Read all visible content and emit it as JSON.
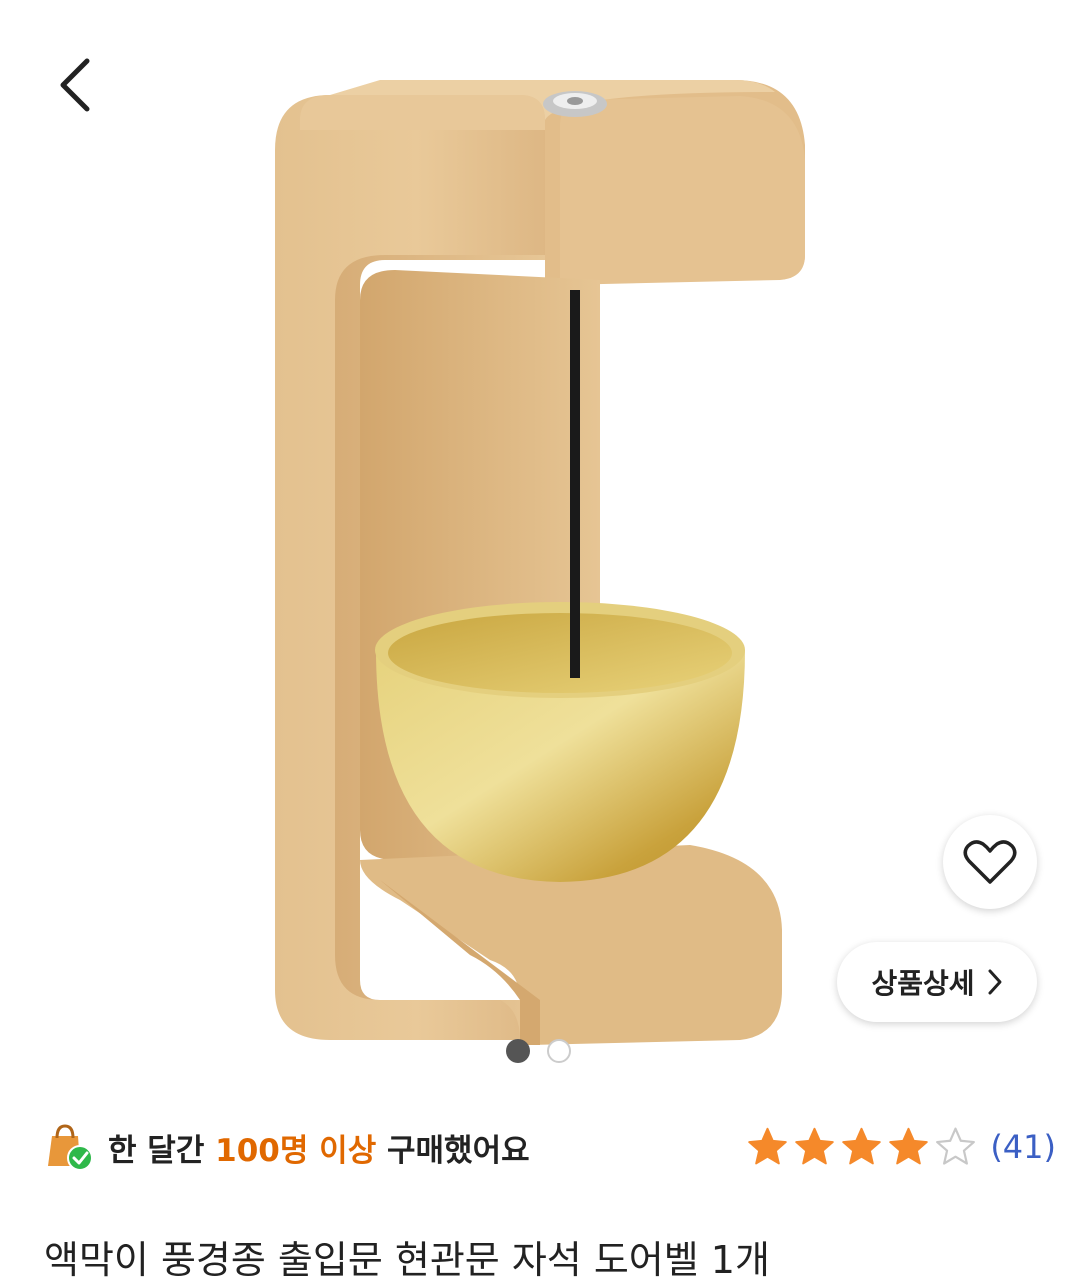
{
  "nav": {
    "back_icon": "chevron-left-icon"
  },
  "product_image": {
    "subject": "wooden-bell-stand",
    "carousel": {
      "total": 2,
      "active_index": 0
    }
  },
  "actions": {
    "wishlist_icon": "heart-outline-icon",
    "detail_label": "상품상세",
    "detail_icon": "chevron-right-icon"
  },
  "purchase_badge": {
    "icon": "shopping-bag-check-icon",
    "prefix": "한 달간 ",
    "highlight": "100명 이상",
    "suffix": " 구매했어요",
    "highlight_color": "#e06800"
  },
  "rating": {
    "stars": 4,
    "max": 5,
    "count_label": "(41)",
    "star_color": "#f5892a"
  },
  "product": {
    "title": "액막이 풍경종 출입문 현관문 자석 도어벨 1개"
  }
}
